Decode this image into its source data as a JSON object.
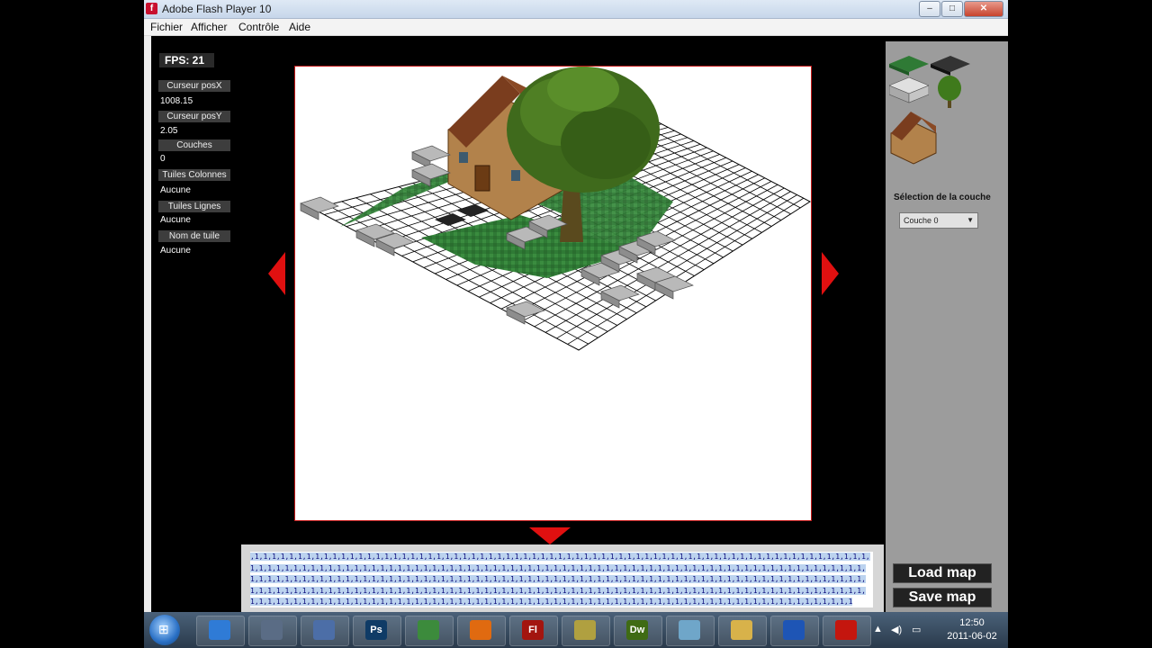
{
  "window": {
    "title": "Adobe Flash Player 10",
    "icon": "flash-icon",
    "controls": [
      "minimize-icon",
      "maximize-icon",
      "close-icon"
    ]
  },
  "menu": [
    "Fichier",
    "Afficher",
    "Contrôle",
    "Aide"
  ],
  "left_panel": {
    "fps": "FPS: 21",
    "fields": [
      {
        "label": "Curseur posX",
        "value": "1008.15"
      },
      {
        "label": "Curseur posY",
        "value": "2.05"
      },
      {
        "label": "Couches",
        "value": "0"
      },
      {
        "label": "Tuiles Colonnes",
        "value": "Aucune"
      },
      {
        "label": "Tuiles Lignes",
        "value": "Aucune"
      },
      {
        "label": "Nom de tuile",
        "value": "Aucune"
      }
    ]
  },
  "right_panel": {
    "tiles": [
      "grass-tile-icon",
      "dark-tile-icon",
      "stone-tile-icon",
      "tree-tile-icon",
      "house-tile-icon"
    ],
    "layer_title": "Sélection de la couche",
    "layer_selected": "Couche 0",
    "load_button": "Load map",
    "save_button": "Save map"
  },
  "code_text": ",1,1,1,1,1,1,1,1,1,1,1,1,1,1,1,1,1,1,1,1,1,1,1,1,1,1,1,1,1,1,1,1,1,1,1,1,1,1,1,1,1,1,1,1,1,1,1,1,1,1,1,1,1,1,1,1,1,1,1,1,1,1,1,1,1,1,1,1,1,1,1,1,1,1,1,1,1,1,1,1,1,1,1,1,1,1,1,1,1,1,1,1,1,1,1,1,1,1,1,1,1,1,1,1,1,1,1,1,1,1,1,1,1,1,1,1,1,1,1,1,1,1,1,1,1,1,1,1,1,1,1,1,1,1,1,1,1,1,1,1,1,1,1,1,1,1,1,1,1,1,1,1,1,1,1,1,1,1,1,1,1,1,1,1,1,1,1,1,1,1,1,1,1,1,1,1,1,1,1,1,1,1,1,1,1,1,1,1,1,1,1,1,1,1,1,1,1,1,1,1,1,1,1,1,1,1,1,1,1,1,1,1,1,1,1,1,1,1,1,1,1,1,1,1,1,1,1,1,1,1,1,1,1,1,1,1,1,1,1,1,1,1,1,1,1,1,1,1,1,1,1,1,1,1,1,1,1,1,1,1,1,1,1,1,1,1,1,1,1,1,1,1,1,1,1,1,1,1,1,1,1,1,1,1,1,1,1,1,1,1,1,1,1,1,1,1,1,1,1,1,1,1,1,1,1,1,1,1,1,1,1,1,1,1,1,1,1,1,1,1,1,1,1,1,1,1,1,1,1,1,1,1,1,1,1,1,1,1,1,1,1,1,1,1,1,1,1,1,1,1,1,1,1,1",
  "taskbar": {
    "apps": [
      {
        "icon": "internet-explorer-icon",
        "label": "",
        "color": "#2f7bd6"
      },
      {
        "icon": "network-icon",
        "label": "",
        "color": "#5a6c85"
      },
      {
        "icon": "ftp-icon",
        "label": "",
        "color": "#4c6ea7"
      },
      {
        "icon": "photoshop-icon",
        "label": "Ps",
        "color": "#0f3b66"
      },
      {
        "icon": "messenger-icon",
        "label": "",
        "color": "#3c8b3c"
      },
      {
        "icon": "firefox-icon",
        "label": "",
        "color": "#e06a10"
      },
      {
        "icon": "flash-cs-icon",
        "label": "Fl",
        "color": "#a3150f"
      },
      {
        "icon": "winamp-icon",
        "label": "",
        "color": "#b0a040"
      },
      {
        "icon": "dreamweaver-icon",
        "label": "Dw",
        "color": "#3f6b14"
      },
      {
        "icon": "notepad-icon",
        "label": "",
        "color": "#6fa6c9"
      },
      {
        "icon": "folder-icon",
        "label": "",
        "color": "#d8b24a"
      },
      {
        "icon": "app-window-icon",
        "label": "",
        "color": "#1e55b5"
      },
      {
        "icon": "flash-player-icon",
        "label": "",
        "color": "#c4160e"
      }
    ],
    "time": "12:50",
    "date": "2011-06-02"
  }
}
